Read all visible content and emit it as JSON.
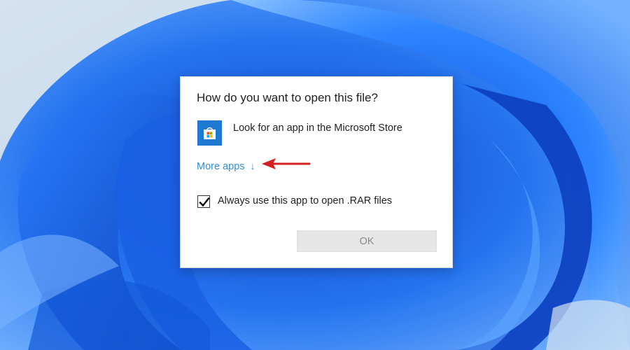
{
  "dialog": {
    "title": "How do you want to open this file?",
    "store_option": {
      "label": "Look for an app in the Microsoft Store",
      "icon": "microsoft-store-icon"
    },
    "more_apps": {
      "label": "More apps",
      "arrow": "↓"
    },
    "always_use": {
      "label": "Always use this app to open .RAR files",
      "checked": true
    },
    "ok_button": {
      "label": "OK",
      "enabled": false
    }
  },
  "annotation": {
    "arrow_color": "#d32020"
  },
  "colors": {
    "link": "#2f8fd8",
    "store_tile": "#1f78d1",
    "wallpaper_blue": "#1e66e6"
  }
}
